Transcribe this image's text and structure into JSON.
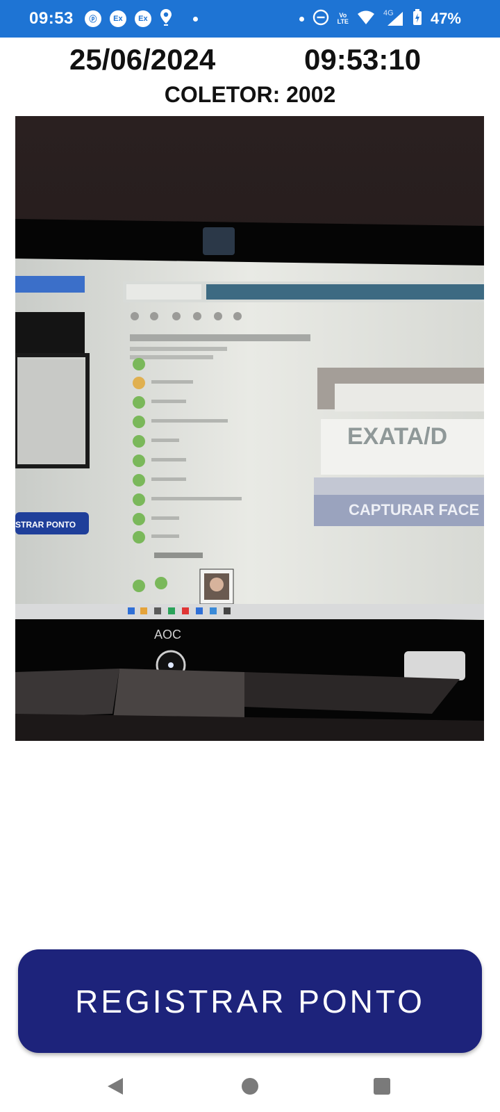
{
  "status_bar": {
    "time": "09:53",
    "left_icons": [
      "shield-app-icon",
      "ex-app-icon",
      "ex-app-icon",
      "location-icon",
      "dot-icon"
    ],
    "app_icon_labels": [
      "ⓟ",
      "Ex",
      "Ex"
    ],
    "volte_label_top": "Vo",
    "volte_label_bottom": "LTE",
    "network_label": "4G",
    "battery_percent": "47%"
  },
  "header": {
    "date": "25/06/2024",
    "time": "09:53:10",
    "collector_label": "COLETOR: 2002"
  },
  "camera": {
    "monitor_brand": "AOC",
    "screen_brand_text": "EXATA/D",
    "screen_button_text": "CAPTURAR FACE",
    "screen_left_button_text": "STRAR PONTO"
  },
  "actions": {
    "register_label": "REGISTRAR PONTO"
  },
  "navigation": {
    "buttons": [
      "back-icon",
      "home-icon",
      "recents-icon"
    ]
  },
  "colors": {
    "status_bar": "#1e74d4",
    "primary_button": "#1d237b",
    "background": "#ffffff"
  }
}
